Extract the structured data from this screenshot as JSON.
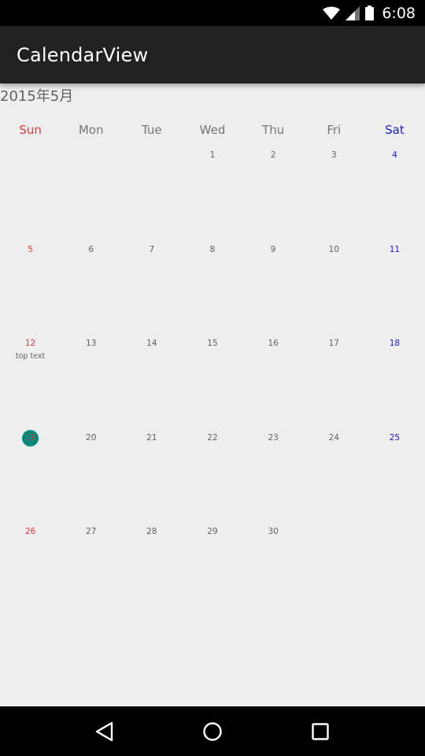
{
  "status_bar": {
    "time": "6:08",
    "icons": [
      "wifi-icon",
      "signal-icon",
      "battery-icon"
    ]
  },
  "app_bar": {
    "title": "CalendarView"
  },
  "calendar": {
    "month_title": "2015年5月",
    "weekdays": [
      "Sun",
      "Mon",
      "Tue",
      "Wed",
      "Thu",
      "Fri",
      "Sat"
    ],
    "colors": {
      "sunday": "#e53935",
      "saturday": "#1a1acc",
      "today_circle": "#00897b"
    },
    "weeks": [
      [
        {
          "day": "",
          "note": ""
        },
        {
          "day": "",
          "note": ""
        },
        {
          "day": "",
          "note": ""
        },
        {
          "day": "1",
          "note": ""
        },
        {
          "day": "2",
          "note": ""
        },
        {
          "day": "3",
          "note": ""
        },
        {
          "day": "4",
          "note": ""
        }
      ],
      [
        {
          "day": "5",
          "note": ""
        },
        {
          "day": "6",
          "note": ""
        },
        {
          "day": "7",
          "note": ""
        },
        {
          "day": "8",
          "note": ""
        },
        {
          "day": "9",
          "note": ""
        },
        {
          "day": "10",
          "note": ""
        },
        {
          "day": "11",
          "note": ""
        }
      ],
      [
        {
          "day": "12",
          "note": "top text"
        },
        {
          "day": "13",
          "note": ""
        },
        {
          "day": "14",
          "note": ""
        },
        {
          "day": "15",
          "note": ""
        },
        {
          "day": "16",
          "note": ""
        },
        {
          "day": "17",
          "note": ""
        },
        {
          "day": "18",
          "note": ""
        }
      ],
      [
        {
          "day": "19",
          "note": "",
          "today": true
        },
        {
          "day": "20",
          "note": ""
        },
        {
          "day": "21",
          "note": ""
        },
        {
          "day": "22",
          "note": ""
        },
        {
          "day": "23",
          "note": ""
        },
        {
          "day": "24",
          "note": ""
        },
        {
          "day": "25",
          "note": ""
        }
      ],
      [
        {
          "day": "26",
          "note": ""
        },
        {
          "day": "27",
          "note": ""
        },
        {
          "day": "28",
          "note": ""
        },
        {
          "day": "29",
          "note": ""
        },
        {
          "day": "30",
          "note": ""
        },
        {
          "day": "",
          "note": ""
        },
        {
          "day": "",
          "note": ""
        }
      ]
    ]
  },
  "nav_bar": {
    "buttons": [
      "back-icon",
      "home-icon",
      "recents-icon"
    ]
  }
}
